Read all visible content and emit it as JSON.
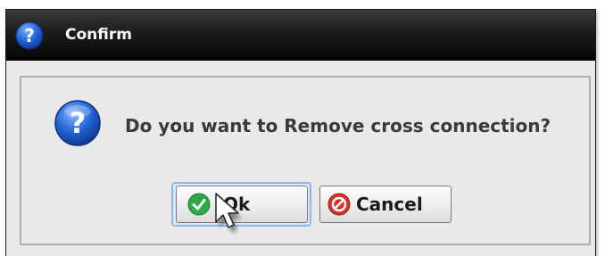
{
  "dialog": {
    "title": "Confirm",
    "title_icon": "question-icon",
    "message": "Do you want to Remove cross connection?",
    "message_icon": "question-icon"
  },
  "buttons": {
    "ok_label": "Ok",
    "ok_icon": "check-circle-icon",
    "cancel_label": "Cancel",
    "cancel_icon": "cancel-circle-icon"
  },
  "colors": {
    "titlebar": "#111111",
    "title_text": "#ffffff",
    "dialog_bg": "#e9e9e9",
    "question_blue": "#1f5fd1",
    "ok_green": "#2fa84a",
    "cancel_red": "#d6322a",
    "focus_blue": "#8fb6e8"
  }
}
